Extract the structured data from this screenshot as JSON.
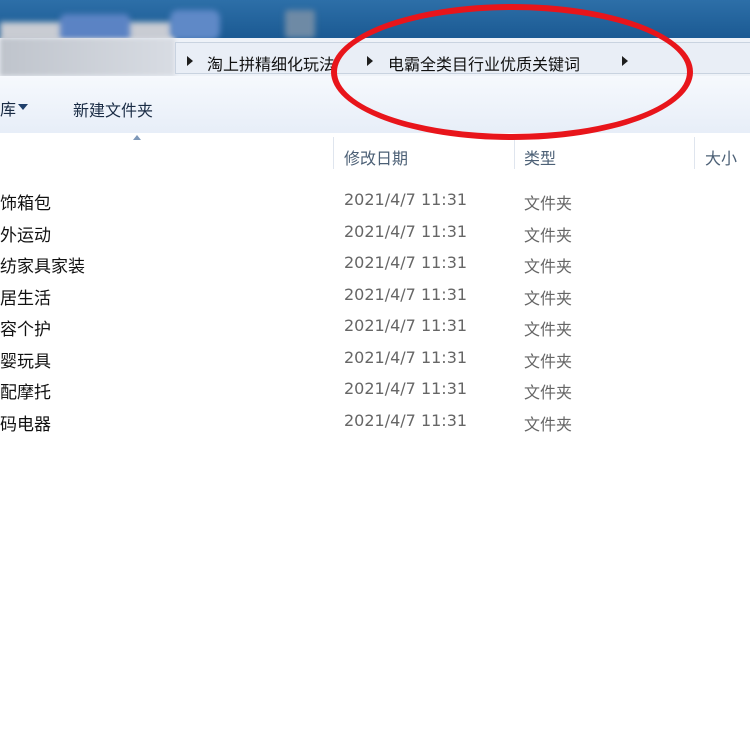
{
  "address_bar": {
    "crumbs": [
      "淘上拼精细化玩法",
      "电霸全类目行业优质关键词"
    ]
  },
  "toolbar": {
    "left_fragment": "库",
    "new_folder_label": "新建文件夹"
  },
  "columns": {
    "modified": "修改日期",
    "type": "类型",
    "size": "大小"
  },
  "rows": [
    {
      "name": "饰箱包",
      "modified": "2021/4/7 11:31",
      "type": "文件夹"
    },
    {
      "name": "外运动",
      "modified": "2021/4/7 11:31",
      "type": "文件夹"
    },
    {
      "name": "纺家具家装",
      "modified": "2021/4/7 11:31",
      "type": "文件夹"
    },
    {
      "name": "居生活",
      "modified": "2021/4/7 11:31",
      "type": "文件夹"
    },
    {
      "name": "容个护",
      "modified": "2021/4/7 11:31",
      "type": "文件夹"
    },
    {
      "name": "婴玩具",
      "modified": "2021/4/7 11:31",
      "type": "文件夹"
    },
    {
      "name": "配摩托",
      "modified": "2021/4/7 11:31",
      "type": "文件夹"
    },
    {
      "name": "码电器",
      "modified": "2021/4/7 11:31",
      "type": "文件夹"
    }
  ],
  "colors": {
    "annotation_red": "#e8151b",
    "title_blue": "#1b5a93"
  }
}
